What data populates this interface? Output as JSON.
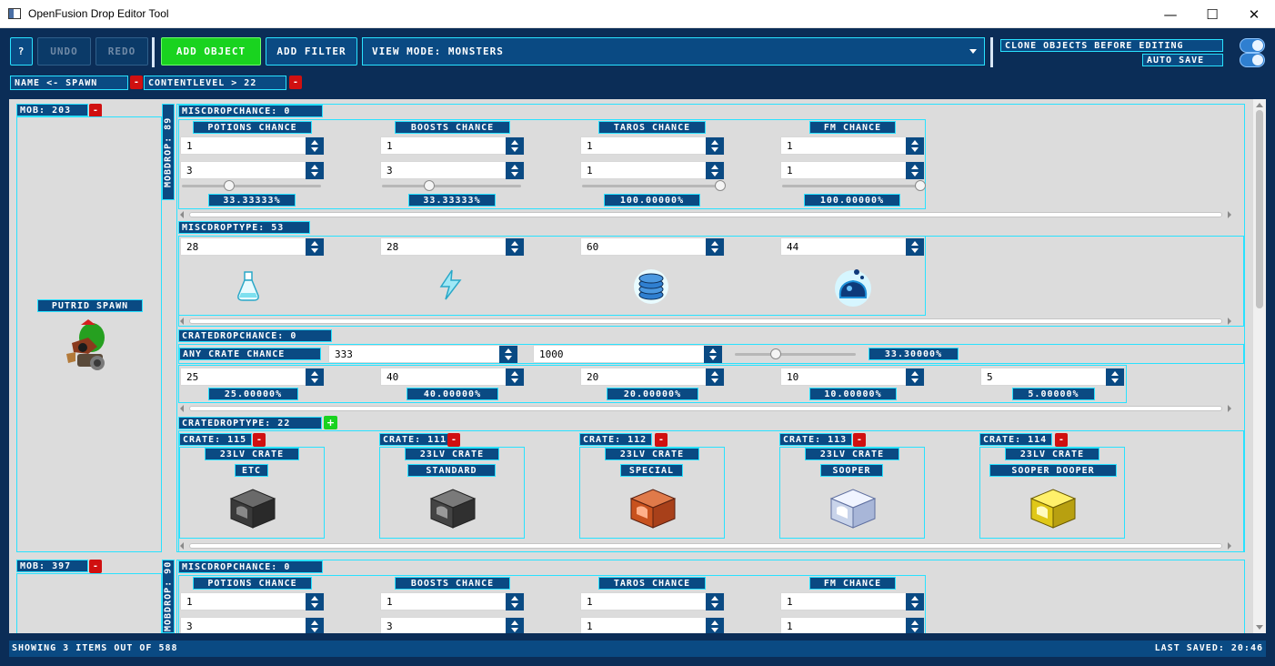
{
  "window": {
    "title": "OpenFusion Drop Editor Tool",
    "minimize": "—",
    "maximize": "☐",
    "close": "✕"
  },
  "toolbar": {
    "help": "?",
    "undo": "Undo",
    "redo": "Redo",
    "add_object": "Add Object",
    "add_filter": "Add Filter",
    "view_mode": "View Mode: Monsters",
    "clone_label": "Clone Objects Before Editing",
    "autosave_label": "Auto Save"
  },
  "filters": [
    {
      "label": "name <- spawn"
    },
    {
      "label": "contentLevel > 22"
    }
  ],
  "mob1": {
    "header": "Mob: 203",
    "name": "Putrid Spawn",
    "mobdrop": "MobDrop: 89",
    "misc_chance": {
      "header": "MiscDropChance: 0",
      "columns": [
        {
          "title": "Potions Chance",
          "v1": "1",
          "v2": "3",
          "pct": "33.33333%"
        },
        {
          "title": "Boosts Chance",
          "v1": "1",
          "v2": "3",
          "pct": "33.33333%"
        },
        {
          "title": "Taros Chance",
          "v1": "1",
          "v2": "1",
          "pct": "100.00000%"
        },
        {
          "title": "FM Chance",
          "v1": "1",
          "v2": "1",
          "pct": "100.00000%"
        }
      ]
    },
    "misc_type": {
      "header": "MiscDropType: 53",
      "values": [
        "28",
        "28",
        "60",
        "44"
      ],
      "icons": [
        "potion-icon",
        "boost-icon",
        "taros-coins-icon",
        "fusion-matter-icon"
      ]
    },
    "crate_chance": {
      "header": "CrateDropChance: 0",
      "any_label": "Any Crate Chance",
      "any_value": "333",
      "any_total": "1000",
      "any_pct": "33.30000%",
      "items": [
        {
          "value": "25",
          "pct": "25.00000%"
        },
        {
          "value": "40",
          "pct": "40.00000%"
        },
        {
          "value": "20",
          "pct": "20.00000%"
        },
        {
          "value": "10",
          "pct": "10.00000%"
        },
        {
          "value": "5",
          "pct": "5.00000%"
        }
      ]
    },
    "crate_type": {
      "header": "CrateDropType: 22",
      "crates": [
        {
          "id": "Crate: 115",
          "name": "23Lv CRATE",
          "kind": "ETC",
          "color": "#3c3c3c"
        },
        {
          "id": "Crate: 111",
          "name": "23Lv CRATE",
          "kind": "STANDARD",
          "color": "#4a4a4a"
        },
        {
          "id": "Crate: 112",
          "name": "23Lv CRATE",
          "kind": "SPECIAL",
          "color": "#c8521e"
        },
        {
          "id": "Crate: 113",
          "name": "23Lv CRATE",
          "kind": "SOOPER",
          "color": "#c9d4ea"
        },
        {
          "id": "Crate: 114",
          "name": "23Lv CRATE",
          "kind": "SOOPER DOOPER",
          "color": "#e0c818"
        }
      ]
    }
  },
  "mob2": {
    "header": "Mob: 397",
    "mobdrop": "MobDrop: 90",
    "misc_chance": {
      "header": "MiscDropChance: 0",
      "columns": [
        {
          "title": "Potions Chance",
          "v1": "1",
          "v2": "3"
        },
        {
          "title": "Boosts Chance",
          "v1": "1",
          "v2": "3"
        },
        {
          "title": "Taros Chance",
          "v1": "1",
          "v2": "1"
        },
        {
          "title": "FM Chance",
          "v1": "1",
          "v2": "1"
        }
      ]
    }
  },
  "status": {
    "left": "Showing 3 items out of 588",
    "right": "Last Saved: 20:46"
  }
}
